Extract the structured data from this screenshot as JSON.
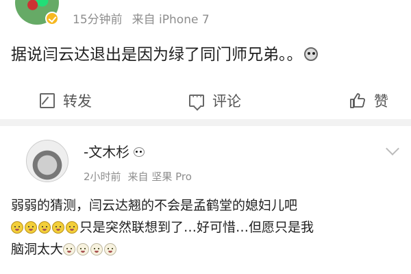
{
  "post": {
    "time": "15分钟前",
    "source": "来自 iPhone 7",
    "text": "据说闫云达退出是因为绿了同门师兄弟。。",
    "actions": {
      "repost": "转发",
      "comment": "评论",
      "like": "赞"
    }
  },
  "comment": {
    "author": "-文木杉",
    "time": "2小时前",
    "source": "来自 坚果 Pro",
    "line1": "弱弱的猜测，闫云达翘的不会是孟鹤堂的媳妇儿吧",
    "line2": "只是突然联想到了…好可惜…但愿只是我",
    "line3": "脑洞太大"
  },
  "icons": {
    "verified": "vip-badge-icon",
    "post_emoji": "skull-emoji-icon",
    "repost": "repost-icon",
    "comment": "comment-icon",
    "like": "thumbs-up-icon",
    "author_emoji": "panda-emoji-icon",
    "more": "chevron-down-icon",
    "comment_emoji": "shy-face-emoji-icon"
  }
}
